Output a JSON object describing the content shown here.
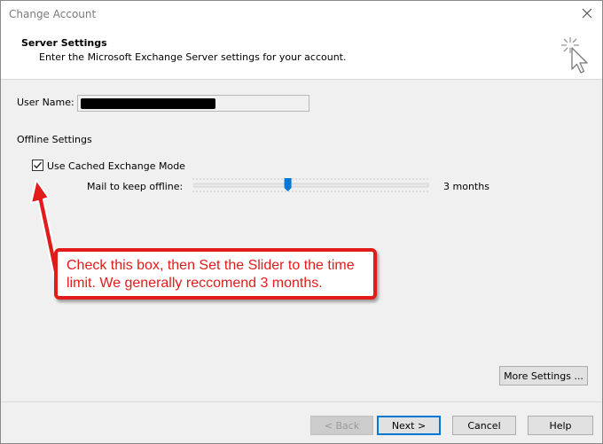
{
  "window": {
    "title": "Change Account",
    "close_icon": "close-icon"
  },
  "header": {
    "title": "Server Settings",
    "subtitle": "Enter the Microsoft Exchange Server settings for your account.",
    "wand_icon": "cursor-sparkle-icon"
  },
  "user": {
    "label": "User Name:",
    "value_redacted": true
  },
  "offline": {
    "section_label": "Offline Settings",
    "cached_mode_label": "Use Cached Exchange Mode",
    "cached_mode_checked": true,
    "mail_label": "Mail to keep offline:",
    "slider_value_text": "3 months",
    "slider_position": 0.4
  },
  "annotation": {
    "text": "Check this box, then Set the Slider to the time limit. We generally reccomend 3 months.",
    "color": "#e21b1b"
  },
  "buttons": {
    "more_settings": "More Settings ...",
    "back": "< Back",
    "next": "Next >",
    "cancel": "Cancel",
    "help": "Help"
  },
  "colors": {
    "accent": "#0078d7",
    "annotation_red": "#e21b1b",
    "window_bg": "#f0f0f0"
  }
}
